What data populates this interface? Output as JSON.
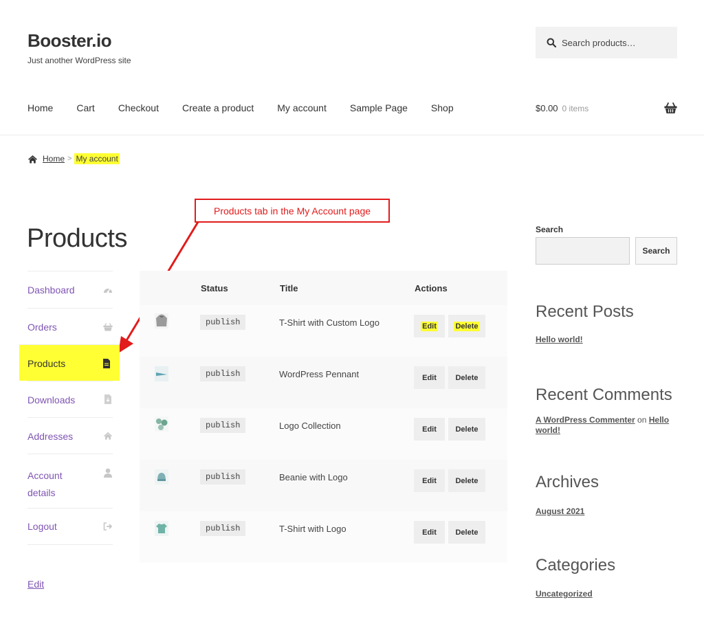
{
  "header": {
    "site_title": "Booster.io",
    "tagline": "Just another WordPress site",
    "search_placeholder": "Search products…",
    "nav": [
      "Home",
      "Cart",
      "Checkout",
      "Create a product",
      "My account",
      "Sample Page",
      "Shop"
    ],
    "cart_total": "$0.00",
    "cart_count": "0 items"
  },
  "breadcrumb": {
    "home": "Home",
    "separator": ">",
    "current": "My account"
  },
  "annotation": {
    "callout_text": "Products tab in the My Account page",
    "color": "#e21b1b"
  },
  "page": {
    "title": "Products"
  },
  "account_nav": [
    {
      "label": "Dashboard",
      "icon": "dashboard-gauge-icon"
    },
    {
      "label": "Orders",
      "icon": "basket-icon"
    },
    {
      "label": "Products",
      "icon": "file-icon",
      "active": true
    },
    {
      "label": "Downloads",
      "icon": "file-download-icon"
    },
    {
      "label": "Addresses",
      "icon": "home-icon"
    },
    {
      "label": "Account details",
      "icon": "user-icon"
    },
    {
      "label": "Logout",
      "icon": "sign-out-icon"
    }
  ],
  "edit_link": "Edit",
  "products_table": {
    "headers": {
      "status": "Status",
      "title": "Title",
      "actions": "Actions"
    },
    "rows": [
      {
        "thumb": "hoodie-thumbnail",
        "status": "publish",
        "title": "T-Shirt with Custom Logo",
        "edit": "Edit",
        "delete": "Delete"
      },
      {
        "thumb": "pennant-thumbnail",
        "status": "publish",
        "title": "WordPress Pennant",
        "edit": "Edit",
        "delete": "Delete"
      },
      {
        "thumb": "logo-collection-thumbnail",
        "status": "publish",
        "title": "Logo Collection",
        "edit": "Edit",
        "delete": "Delete"
      },
      {
        "thumb": "beanie-thumbnail",
        "status": "publish",
        "title": "Beanie with Logo",
        "edit": "Edit",
        "delete": "Delete"
      },
      {
        "thumb": "tshirt-thumbnail",
        "status": "publish",
        "title": "T-Shirt with Logo",
        "edit": "Edit",
        "delete": "Delete"
      }
    ]
  },
  "sidebar": {
    "search_label": "Search",
    "search_button": "Search",
    "recent_posts_title": "Recent Posts",
    "recent_post": "Hello world!",
    "recent_comments_title": "Recent Comments",
    "comment_author": "A WordPress Commenter",
    "comment_on": "on",
    "comment_post_line1": "Hello",
    "comment_post_line2": "world!",
    "archives_title": "Archives",
    "archive": "August 2021",
    "categories_title": "Categories",
    "category": "Uncategorized"
  },
  "colors": {
    "link_purple": "#7f54b3",
    "highlight_yellow": "#ffff33",
    "annotation_red": "#e21b1b"
  }
}
